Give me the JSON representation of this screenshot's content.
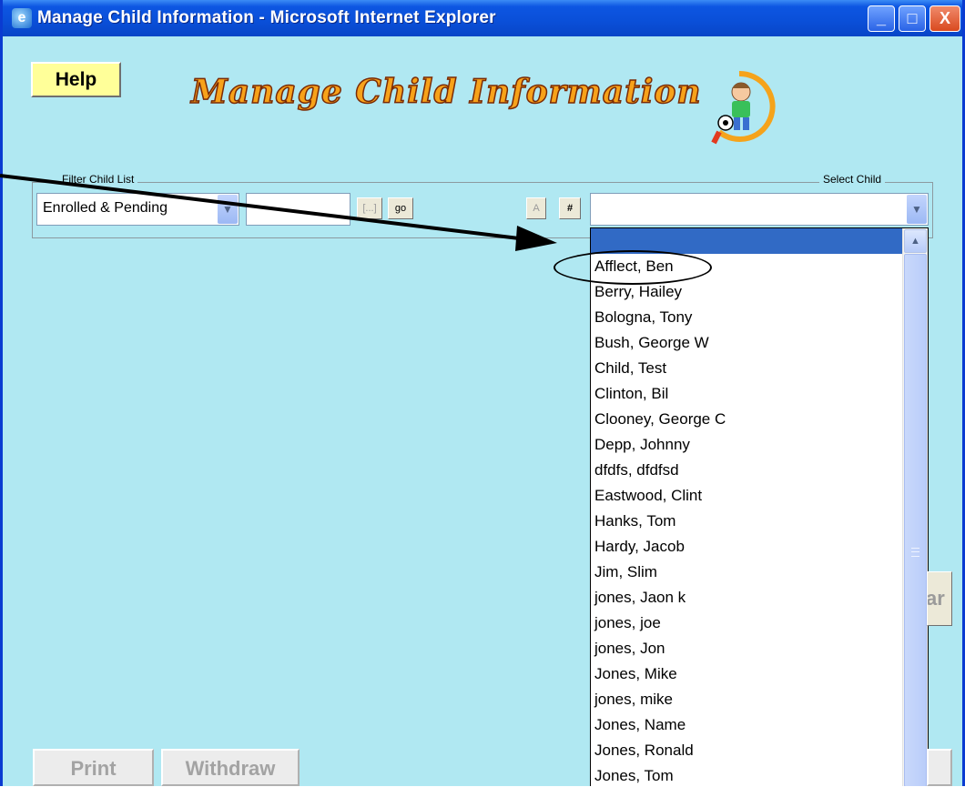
{
  "window": {
    "title": "Manage Child Information - Microsoft Internet Explorer",
    "minimize_glyph": "_",
    "maximize_glyph": "□",
    "close_glyph": "X"
  },
  "page": {
    "help_label": "Help",
    "banner_title": "Manage Child Information"
  },
  "filter": {
    "legend": "Filter Child List",
    "status_value": "Enrolled & Pending",
    "search_value": "",
    "dots_label": "[...]",
    "go_label": "go",
    "alpha_label": "A",
    "number_label": "#"
  },
  "select_child": {
    "legend": "Select Child",
    "value": "",
    "options": [
      "Afflect, Ben",
      "Berry, Hailey",
      "Bologna, Tony",
      "Bush, George W",
      "Child, Test",
      "Clinton, Bil",
      "Clooney, George C",
      "Depp, Johnny",
      "dfdfs, dfdfsd",
      "Eastwood, Clint",
      "Hanks, Tom",
      "Hardy, Jacob",
      "Jim, Slim",
      "jones, Jaon k",
      "jones, joe",
      "jones, Jon",
      "Jones, Mike",
      "jones, mike",
      "Jones, Name",
      "Jones, Ronald",
      "Jones, Tom"
    ]
  },
  "buttons": {
    "print_label": "Print",
    "withdraw_label": "Withdraw",
    "partial_label": "ar"
  },
  "icons": {
    "dropdown": "chevron-down-icon",
    "scroll_up": "chevron-up-icon",
    "window_app": "ie-icon"
  }
}
